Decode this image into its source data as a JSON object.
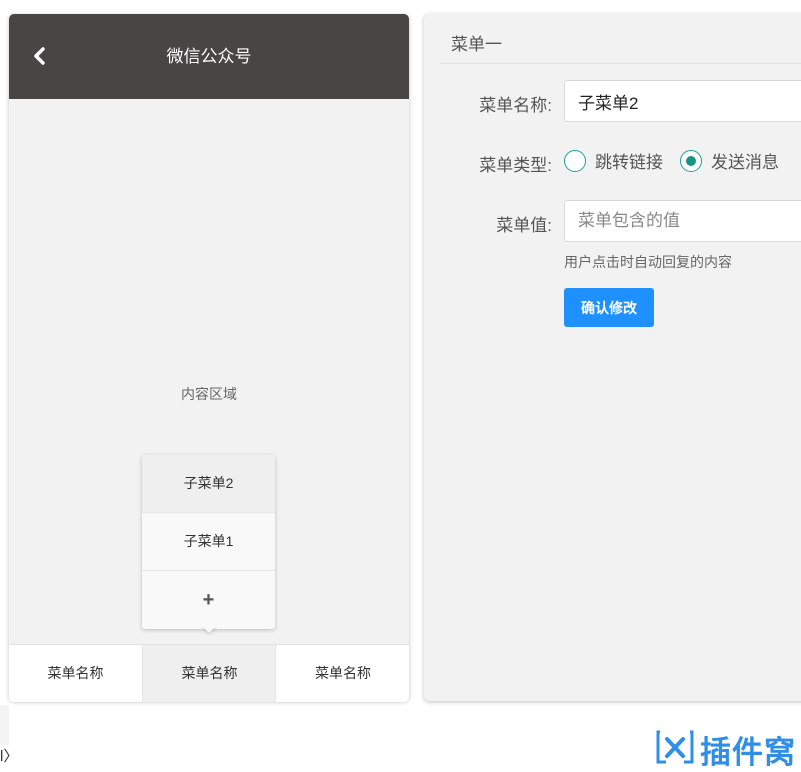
{
  "phone": {
    "header_title": "微信公众号",
    "content_area_label": "内容区域",
    "submenu": {
      "items": [
        {
          "label": "子菜单2",
          "active": true
        },
        {
          "label": "子菜单1",
          "active": false
        }
      ],
      "add_label": "+"
    },
    "bottom_menu": [
      {
        "label": "菜单名称",
        "active": false
      },
      {
        "label": "菜单名称",
        "active": true
      },
      {
        "label": "菜单名称",
        "active": false
      }
    ]
  },
  "editor": {
    "title": "菜单一",
    "name_label": "菜单名称:",
    "name_value": "子菜单2",
    "type_label": "菜单类型:",
    "type_options": [
      {
        "label": "跳转链接",
        "checked": false
      },
      {
        "label": "发送消息",
        "checked": true
      }
    ],
    "value_label": "菜单值:",
    "value_placeholder": "菜单包含的值",
    "value_hint": "用户点击时自动回复的内容",
    "confirm_label": "确认修改"
  },
  "misc": {
    "stray_text": "l〉"
  },
  "watermark": {
    "text": "插件窝"
  },
  "colors": {
    "header_bg": "#474645",
    "accent_green": "#159688",
    "button_blue": "#1e90ff",
    "watermark_blue": "#2f8fe8"
  }
}
